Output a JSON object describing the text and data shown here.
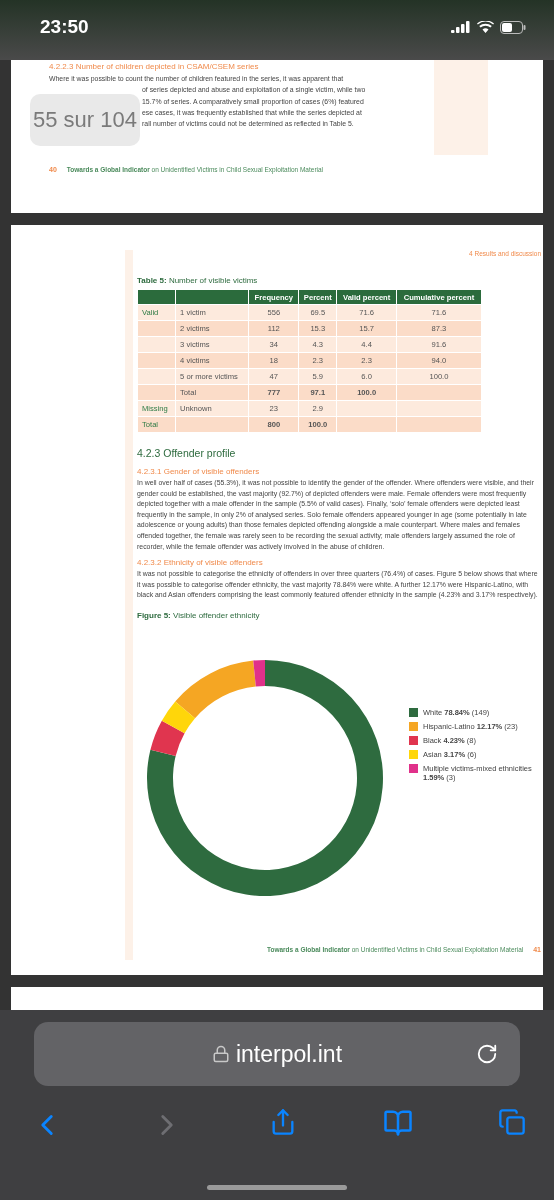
{
  "status_bar": {
    "time": "23:50"
  },
  "page_badge": "55 sur 104",
  "page_40": {
    "section_heading": "4.2.2.3 Number of children depicted in CSAM/CSEM series",
    "paragraph_lines": [
      {
        "text": "Where it was possible to count the number of children featured in the series, it was apparent that",
        "covered": false
      },
      {
        "text": "of series depicted and abuse and exploitation of a single victim, while two",
        "covered": true
      },
      {
        "text": "15.7% of series. A comparatively small proportion of cases (6%) featured",
        "covered": true
      },
      {
        "text": "ese cases, it was frequently established that while the series depicted at",
        "covered": true
      },
      {
        "text": "rall number of victims could not be determined as reflected in Table 5.",
        "covered": true
      }
    ],
    "footer": {
      "page_number": "40",
      "title": "**Towards a Global Indicator** on Unidentified Victims in Child Sexual Exploitation Material"
    }
  },
  "page_41": {
    "running_header": "4 Results and discussion",
    "table": {
      "caption_label": "Table 5:",
      "caption": "Number of visible victims",
      "columns": [
        "Frequency",
        "Percent",
        "Valid percent",
        "Cumulative percent"
      ],
      "rows": [
        {
          "kind": "value",
          "group": "Valid",
          "label": "1 victim",
          "cells": [
            "556",
            "69.5",
            "71.6",
            "71.6"
          ]
        },
        {
          "kind": "value",
          "label": "2 victims",
          "cells": [
            "112",
            "15.3",
            "15.7",
            "87.3"
          ]
        },
        {
          "kind": "value",
          "label": "3 victims",
          "cells": [
            "34",
            "4.3",
            "4.4",
            "91.6"
          ]
        },
        {
          "kind": "value",
          "label": "4 victims",
          "cells": [
            "18",
            "2.3",
            "2.3",
            "94.0"
          ]
        },
        {
          "kind": "value",
          "label": "5 or more victims",
          "cells": [
            "47",
            "5.9",
            "6.0",
            "100.0"
          ]
        },
        {
          "kind": "total",
          "label": "Total",
          "cells": [
            "777",
            "97.1",
            "100.0"
          ]
        },
        {
          "kind": "value",
          "group": "Missing",
          "label": "Unknown",
          "cells": [
            "23",
            "2.9"
          ]
        },
        {
          "kind": "total",
          "group": "Total",
          "cells": [
            "800",
            "100.0"
          ]
        }
      ]
    },
    "section_heading": "4.2.3 Offender profile",
    "subsections": [
      {
        "heading": "4.2.3.1 Gender of visible offenders",
        "paragraph": "In well over half of cases (55.3%), it was not possible to identify the gender of the offender. Where offenders were visible, and their gender could be established, the vast majority (92.7%) of depicted offenders were male. Female offenders were most frequently depicted together with a male offender in the sample (5.5% of valid cases). Finally, ‘solo’ female offenders were depicted least frequently in the sample, in only 2% of analysed series. Solo female offenders appeared younger in age (some potentially in late adolescence or young adults) than those females depicted offending alongside a male counterpart. Where males and females offended together, the female was rarely seen to be recording the sexual activity; male offenders largely assumed the role of recorder, while the female offender was actively involved in the abuse of children."
      },
      {
        "heading": "4.2.3.2 Ethnicity of visible offenders",
        "paragraph": "It was not possible to categorise the ethnicity of offenders in over three quarters (76.4%) of cases. Figure 5 below shows that where it was possible to categorise offender ethnicity, the vast majority 78.84% were white. A further 12.17% were Hispanic-Latino, with black and Asian offenders comprising the least commonly featured offender ethnicity in the sample (4.23% and 3.17% respectively)."
      }
    ],
    "figure": {
      "caption_label": "Figure 5:",
      "caption": "Visible offender ethnicity",
      "chart_data": {
        "type": "donut",
        "categories": [
          "White",
          "Hispanic-Latino",
          "Black",
          "Asian",
          "Multiple victims-mixed ethnicities"
        ],
        "values": [
          78.84,
          12.17,
          4.23,
          3.17,
          1.59
        ]
      },
      "legend": [
        {
          "reading": "**78.84%** (149)",
          "color": "#2e6b3f"
        },
        {
          "reading": "**12.17%** (23)",
          "color": "#f5a623"
        },
        {
          "reading": "**4.23%** (8)",
          "color": "#e0354f"
        },
        {
          "reading": "**3.17%** (6)",
          "color": "#ffd60a"
        },
        {
          "reading": "**1.59%** (3)",
          "color": "#e0318a"
        }
      ]
    },
    "footer": {
      "page_number": "41",
      "title": "**Towards a Global Indicator** on Unidentified Victims in Child Sexual Exploitation Material"
    }
  },
  "address_bar": {
    "url": "interpol.int"
  },
  "toolbar": [
    {
      "kind": "back",
      "disabled": false
    },
    {
      "kind": "forward",
      "disabled": true
    },
    {
      "kind": "share",
      "disabled": false
    },
    {
      "kind": "bookmarks",
      "disabled": false
    },
    {
      "kind": "tabs",
      "disabled": false
    }
  ]
}
